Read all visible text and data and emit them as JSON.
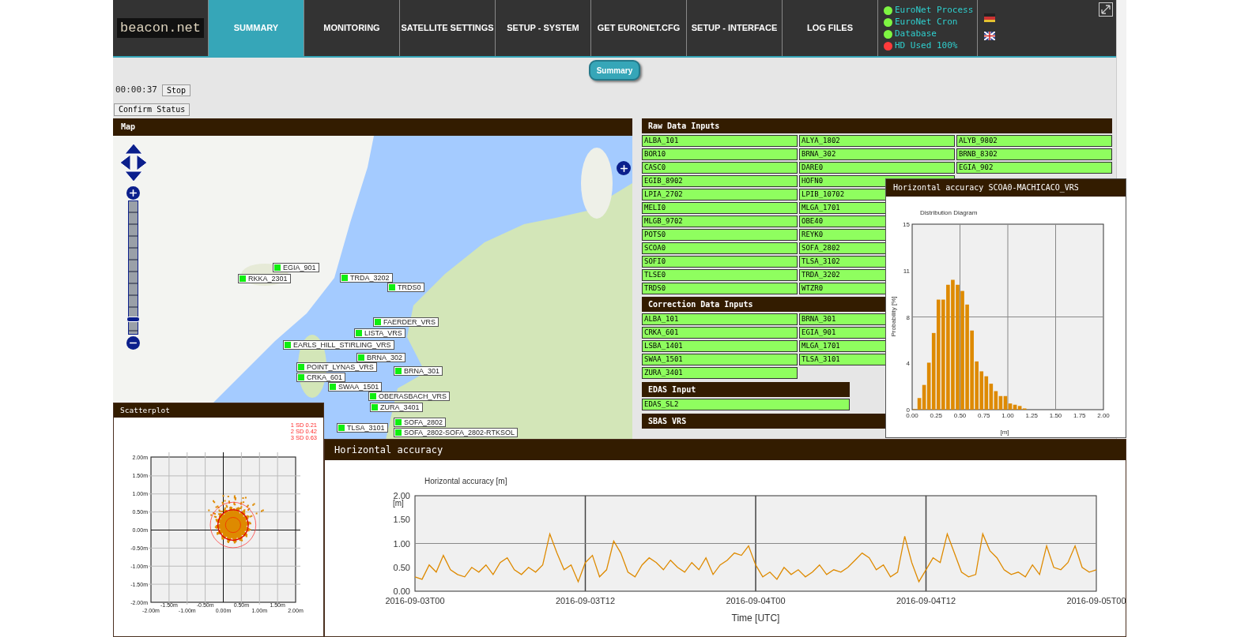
{
  "header": {
    "logo": "beacon.net",
    "tabs": [
      {
        "label": "SUMMARY",
        "selected": true
      },
      {
        "label": "MONITORING",
        "selected": false
      },
      {
        "label": "SATELLITE SETTINGS",
        "selected": false
      },
      {
        "label": "SETUP - SYSTEM",
        "selected": false
      },
      {
        "label": "GET EURONET.CFG",
        "selected": false
      },
      {
        "label": "SETUP - INTERFACE",
        "selected": false
      },
      {
        "label": "LOG FILES",
        "selected": false
      }
    ],
    "status": [
      {
        "label": "EuroNet Process",
        "color": "#7ef542"
      },
      {
        "label": "EuroNet Cron",
        "color": "#7ef542"
      },
      {
        "label": "Database",
        "color": "#7ef542"
      },
      {
        "label": "HD Used 100%",
        "color": "#ff3b3b"
      }
    ]
  },
  "page_button": "Summary",
  "timer": {
    "value": "00:00:37",
    "stop_button": "Stop"
  },
  "confirm_button": "Confirm Status",
  "map": {
    "title": "Map",
    "zoom": {
      "level": 0.1
    },
    "markers": [
      {
        "label": "EGIA_901"
      },
      {
        "label": "RKKA_2301"
      },
      {
        "label": "TRDA_3202"
      },
      {
        "label": "TRDS0"
      },
      {
        "label": "FAERDER_VRS"
      },
      {
        "label": "LISTA_VRS"
      },
      {
        "label": "EARLS_HILL_STIRLING_VRS"
      },
      {
        "label": "BRNA_302"
      },
      {
        "label": "POINT_LYNAS_VRS"
      },
      {
        "label": "BRNA_301"
      },
      {
        "label": "CRKA_601"
      },
      {
        "label": "SWAA_1501"
      },
      {
        "label": "OBERASBACH_VRS"
      },
      {
        "label": "ZURA_3401"
      },
      {
        "label": "TLSA_3101"
      },
      {
        "label": "SOFA_2802"
      },
      {
        "label": "SOFA_2802-SOFA_2802-RTKSOL"
      }
    ]
  },
  "raw_inputs": {
    "title": "Raw Data Inputs",
    "rows": [
      [
        "ALBA_101",
        "ALYA_1802",
        "ALYB_9802"
      ],
      [
        "BOR10",
        "BRNA_302",
        "BRNB_8302"
      ],
      [
        "CASC0",
        "DARE0",
        "EGIA_902"
      ],
      [
        "EGIB_8902",
        "HOFN0"
      ],
      [
        "LPIA_2702",
        "LPIB_10702"
      ],
      [
        "MELI0",
        "MLGA_1701"
      ],
      [
        "MLGB_9702",
        "OBE40"
      ],
      [
        "POTS0",
        "REYK0"
      ],
      [
        "SCOA0",
        "SOFA_2802"
      ],
      [
        "SOFI0",
        "TLSA_3102"
      ],
      [
        "TLSE0",
        "TRDA_3202"
      ],
      [
        "TRDS0",
        "WTZR0"
      ]
    ]
  },
  "correction_inputs": {
    "title": "Correction Data Inputs",
    "rows": [
      [
        "ALBA_101",
        "BRNA_301"
      ],
      [
        "CRKA_601",
        "EGIA_901"
      ],
      [
        "LSBA_1401",
        "MLGA_1701"
      ],
      [
        "SWAA_1501",
        "TLSA_3101"
      ],
      [
        "ZURA_3401"
      ]
    ]
  },
  "edas": {
    "title": "EDAS Input",
    "items": [
      "EDAS_SL2"
    ]
  },
  "sbas": {
    "title": "SBAS VRS"
  },
  "distribution": {
    "title": "Horizontal accuracy SCOA0-MACHICACO_VRS",
    "chart_data": {
      "type": "bar",
      "grid": true,
      "title": "Distribution Diagram",
      "xlabel": "[m]",
      "ylabel": "Probability [%]",
      "x": [
        0.025,
        0.075,
        0.125,
        0.175,
        0.225,
        0.275,
        0.325,
        0.375,
        0.425,
        0.475,
        0.525,
        0.575,
        0.625,
        0.675,
        0.725,
        0.775,
        0.825,
        0.875,
        0.925,
        0.975,
        1.025,
        1.075,
        1.125,
        1.175
      ],
      "values": [
        0.04,
        0.94,
        2.0,
        3.8,
        6.2,
        8.9,
        8.9,
        10.1,
        10.5,
        10.1,
        9.6,
        8.5,
        6.4,
        3.9,
        3.1,
        2.7,
        2.1,
        1.5,
        1.1,
        1.1,
        0.5,
        0.4,
        0.3,
        0.1
      ],
      "xlim": [
        0,
        2
      ],
      "ylim": [
        0,
        15
      ],
      "xticks": [
        {
          "value": 0,
          "label": "0.00"
        },
        {
          "value": 0.25,
          "label": "0.25"
        },
        {
          "value": 0.5,
          "label": "0.50"
        },
        {
          "value": 0.75,
          "label": "0.75"
        },
        {
          "value": 1,
          "label": "1.00"
        },
        {
          "value": 1.25,
          "label": "1.25"
        },
        {
          "value": 1.5,
          "label": "1.50"
        },
        {
          "value": 1.75,
          "label": "1.75"
        },
        {
          "value": 2,
          "label": "2.00"
        }
      ],
      "yticks": [
        {
          "value": 0,
          "label": "0"
        },
        {
          "value": 3.75,
          "label": "4"
        },
        {
          "value": 7.5,
          "label": "8"
        },
        {
          "value": 11.25,
          "label": "11"
        },
        {
          "value": 15,
          "label": "15"
        }
      ]
    }
  },
  "scatterplot": {
    "title": "Scatterplot",
    "sd_labels": [
      "1 SD 0.21",
      "2 SD 0.42",
      "3 SD 0.63"
    ],
    "y_ticks": [
      "2.00m",
      "1.50m",
      "1.00m",
      "0.50m",
      "0.00m",
      "-0.50m",
      "-1.00m",
      "-1.50m",
      "-2.00m"
    ],
    "x_ticks": [
      "-2.00m",
      "-1.50m",
      "-1.00m",
      "-0.50m",
      "0.00m",
      "0.50m",
      "1.00m",
      "1.50m",
      "2.00m"
    ]
  },
  "accuracy": {
    "title": "Horizontal accuracy",
    "chart_data": {
      "type": "line",
      "grid": true,
      "ref_lines": [
        {
          "axis": "y",
          "value": 1
        }
      ],
      "title": "Horizontal accuracy [m]",
      "xlabel": "Time [UTC]",
      "ylabel": "[m]",
      "categories": [
        "2016-09-03T00",
        null,
        null,
        null,
        null,
        null,
        null,
        null,
        null,
        null,
        null,
        null,
        null,
        null,
        null,
        null,
        null,
        null,
        null,
        null,
        null,
        null,
        null,
        null,
        "2016-09-03T12",
        null,
        null,
        null,
        null,
        null,
        null,
        null,
        null,
        null,
        null,
        null,
        null,
        null,
        null,
        null,
        null,
        null,
        null,
        null,
        null,
        null,
        null,
        null,
        "2016-09-04T00",
        null,
        null,
        null,
        null,
        null,
        null,
        null,
        null,
        null,
        null,
        null,
        null,
        null,
        null,
        null,
        null,
        null,
        null,
        null,
        null,
        null,
        null,
        null,
        "2016-09-04T12",
        null,
        null,
        null,
        null,
        null,
        null,
        null,
        null,
        null,
        null,
        null,
        null,
        null,
        null,
        null,
        null,
        null,
        null,
        null,
        null,
        null,
        null,
        null,
        "2016-09-05T00"
      ],
      "values": [
        0.3,
        0.25,
        0.55,
        0.4,
        0.75,
        0.45,
        0.35,
        0.3,
        0.5,
        0.4,
        0.55,
        0.35,
        0.6,
        0.7,
        0.45,
        0.35,
        0.5,
        0.4,
        0.55,
        1.2,
        0.8,
        0.45,
        0.55,
        0.2,
        0.6,
        0.75,
        0.3,
        0.45,
        1.05,
        0.8,
        0.4,
        0.3,
        0.55,
        0.7,
        0.6,
        0.45,
        0.65,
        0.5,
        0.4,
        0.6,
        0.45,
        0.7,
        0.35,
        0.55,
        0.65,
        0.8,
        0.75,
        0.95,
        0.55,
        0.3,
        0.4,
        0.25,
        0.5,
        0.35,
        0.45,
        0.3,
        0.4,
        0.55,
        0.35,
        0.45,
        0.4,
        0.5,
        0.65,
        0.8,
        0.7,
        0.45,
        0.55,
        0.3,
        0.4,
        1.15,
        0.6,
        0.2,
        0.45,
        0.7,
        0.6,
        1.2,
        0.8,
        0.4,
        0.3,
        0.35,
        1.2,
        0.85,
        0.7,
        0.45,
        0.35,
        0.4,
        0.3,
        0.55,
        0.35,
        0.95,
        0.5,
        0.45,
        0.6,
        0.95,
        0.5,
        0.4,
        0.45
      ],
      "ylim": [
        0,
        2
      ],
      "yticks": [
        {
          "value": 0,
          "label": "0.00"
        },
        {
          "value": 0.5,
          "label": "0.50"
        },
        {
          "value": 1,
          "label": "1.00"
        },
        {
          "value": 1.5,
          "label": "1.50"
        },
        {
          "value": 2,
          "label": "2.00"
        }
      ]
    }
  }
}
